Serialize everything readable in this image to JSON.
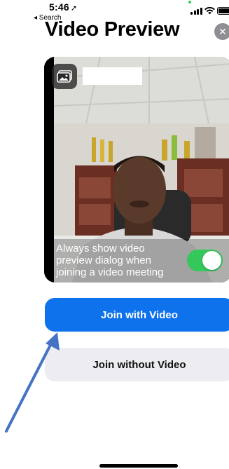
{
  "status_bar": {
    "time": "5:46",
    "location_glyph": "➚",
    "back_label": "◂ Search"
  },
  "header": {
    "title": "Video Preview",
    "close_glyph": "✕"
  },
  "preview": {
    "background_icon": "image-icon",
    "toggle_label": "Always show video preview dialog when joining a video meeting",
    "toggle_on": true
  },
  "actions": {
    "join_with_video": "Join with Video",
    "join_without_video": "Join without Video"
  },
  "colors": {
    "primary": "#0e72ed",
    "toggle_on": "#34c759",
    "secondary_button": "#ededf1",
    "annotation_arrow": "#4472c4"
  }
}
